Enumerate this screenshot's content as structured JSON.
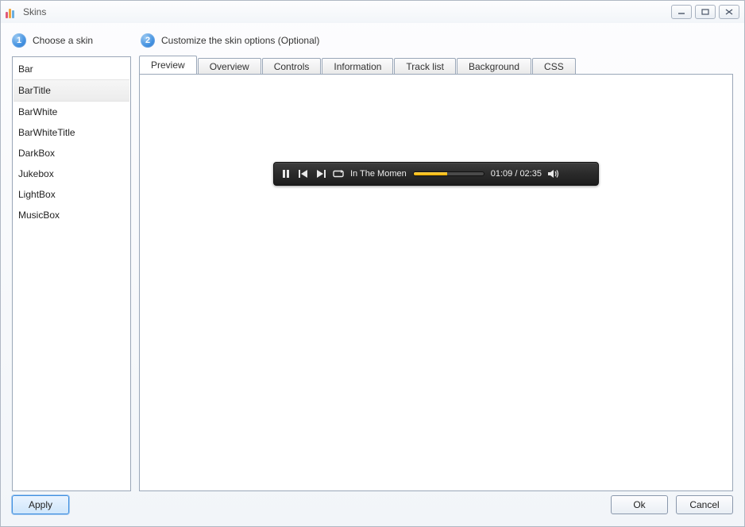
{
  "window": {
    "title": "Skins"
  },
  "steps": {
    "one_num": "1",
    "one_label": "Choose a skin",
    "two_num": "2",
    "two_label": "Customize the skin options (Optional)"
  },
  "skins": {
    "items": [
      "Bar",
      "BarTitle",
      "BarWhite",
      "BarWhiteTitle",
      "DarkBox",
      "Jukebox",
      "LightBox",
      "MusicBox"
    ],
    "selected_index": 1
  },
  "tabs": {
    "items": [
      "Preview",
      "Overview",
      "Controls",
      "Information",
      "Track list",
      "Background",
      "CSS"
    ],
    "active_index": 0
  },
  "player": {
    "track_title": "In The Momen",
    "time_current": "01:09",
    "time_total": "02:35",
    "progress_pct": 48
  },
  "buttons": {
    "apply": "Apply",
    "ok": "Ok",
    "cancel": "Cancel"
  }
}
